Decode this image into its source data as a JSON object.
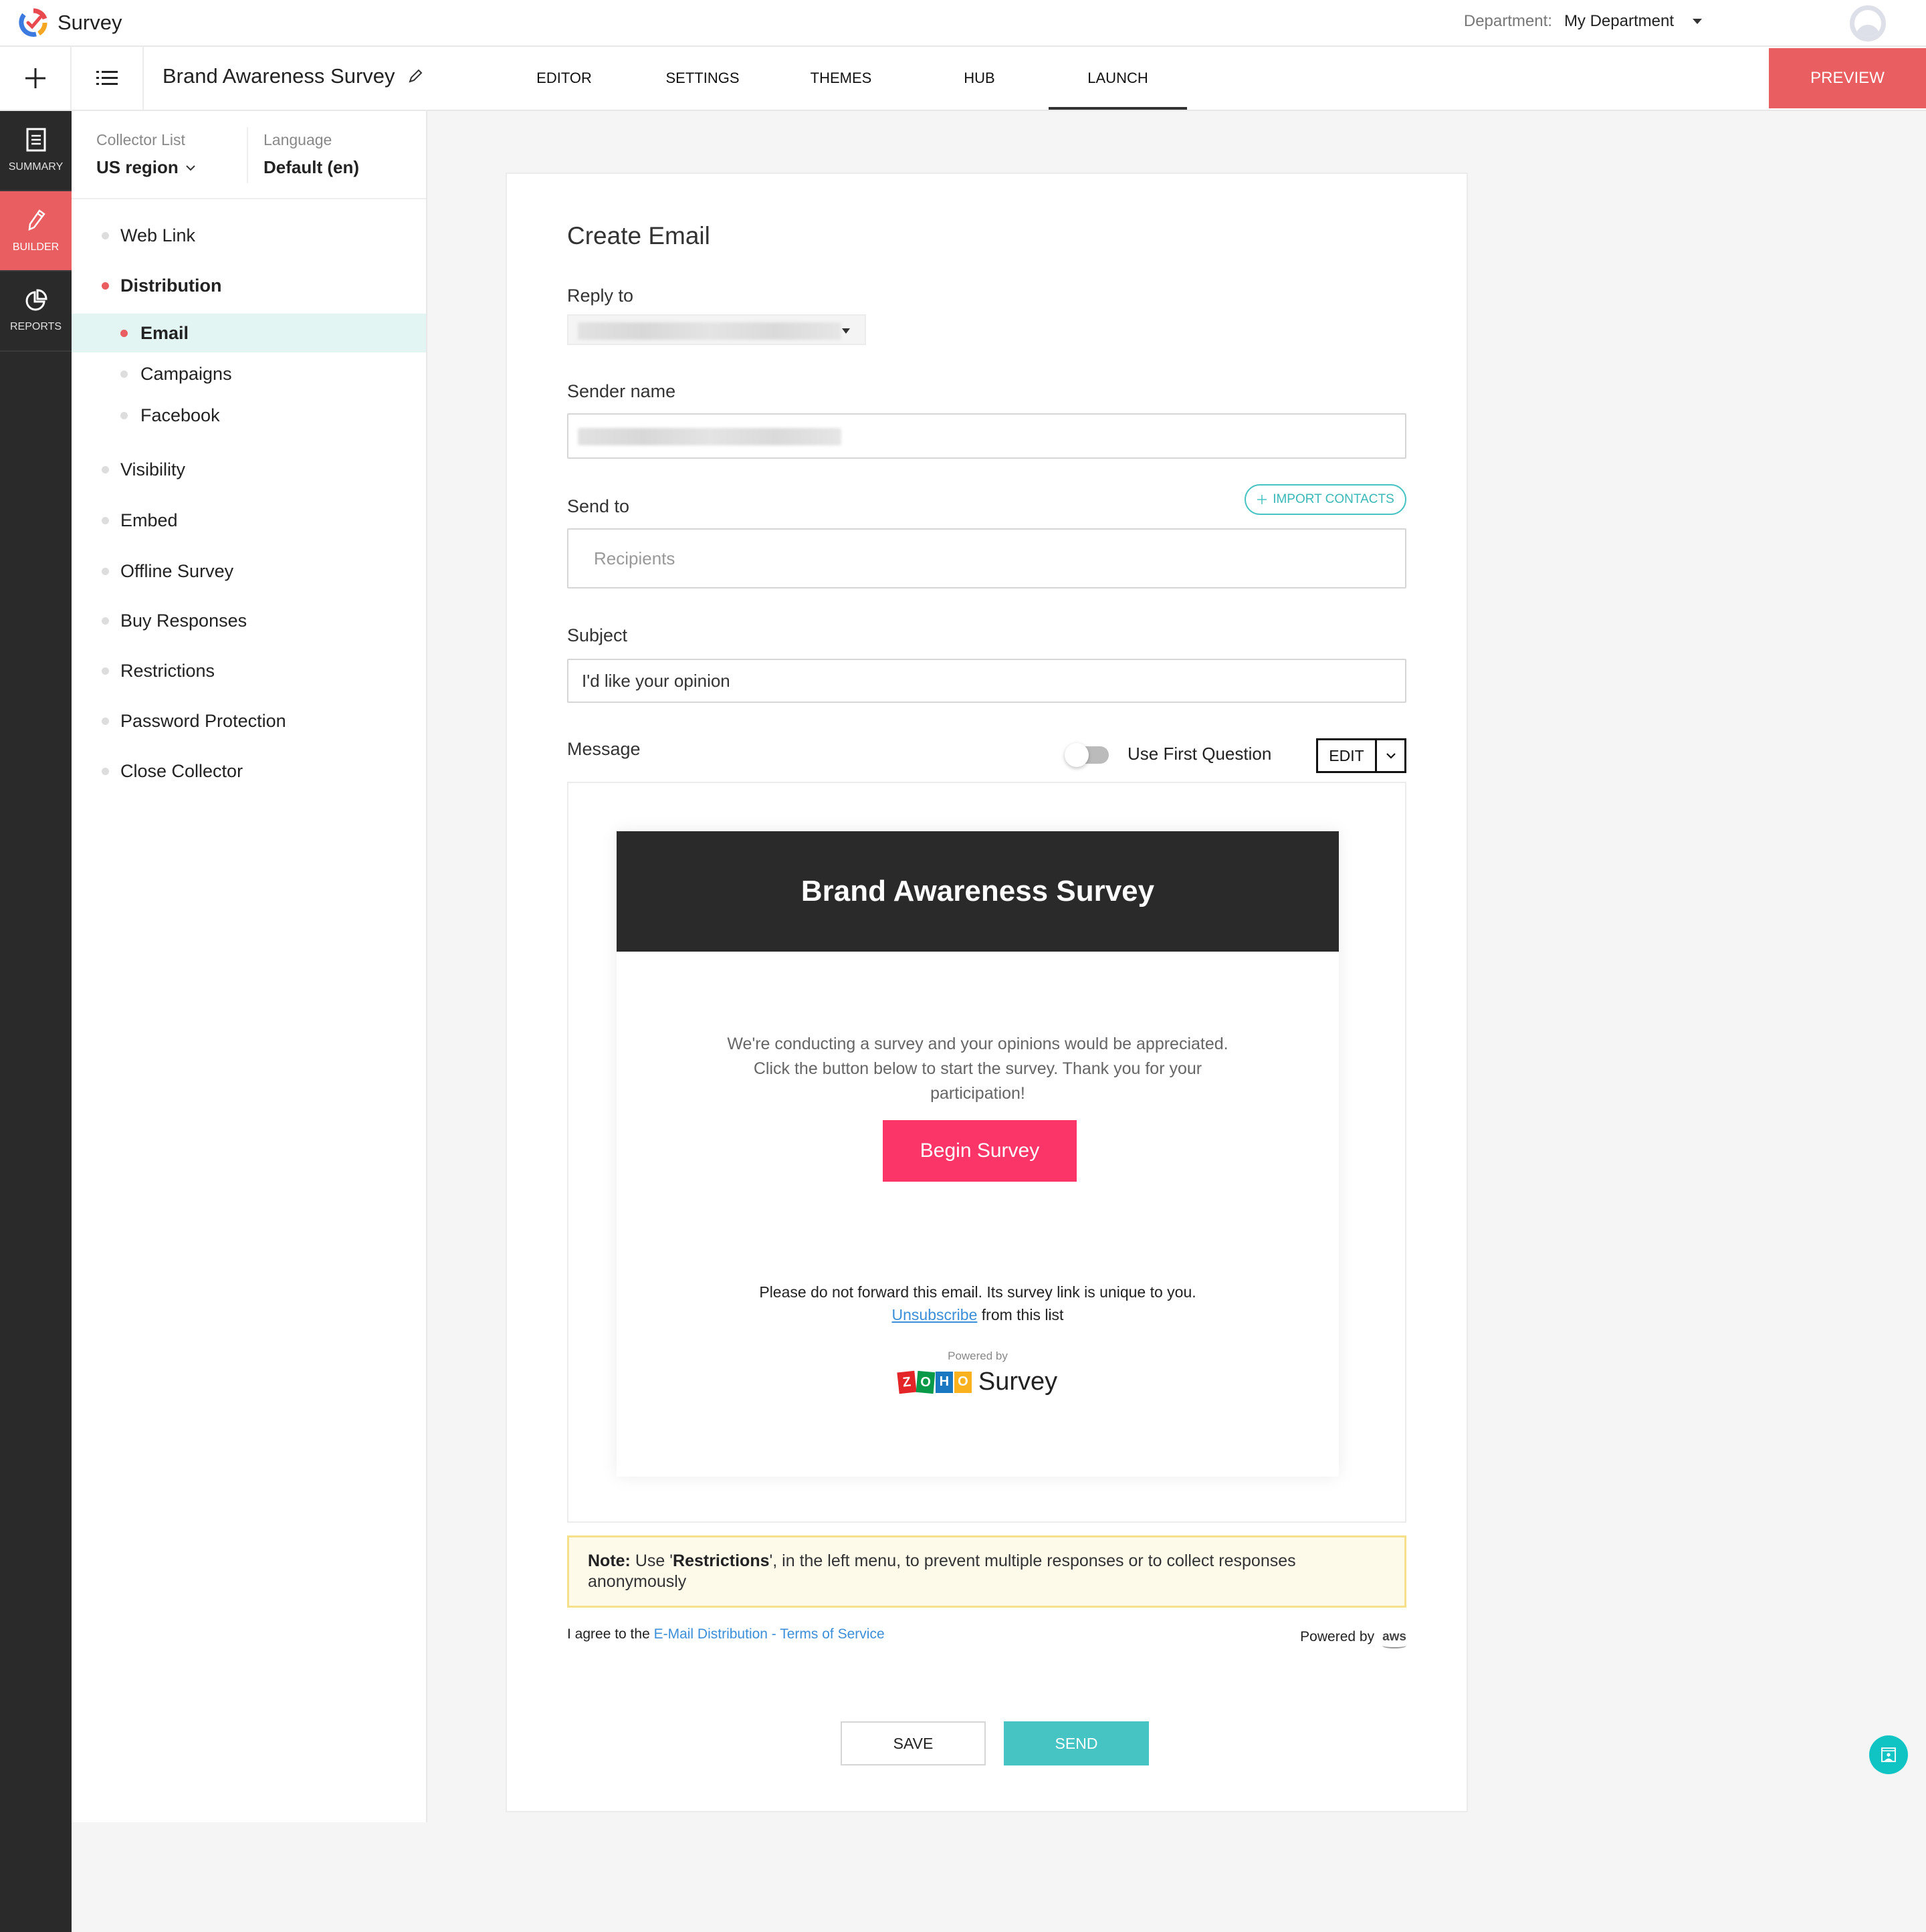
{
  "app": {
    "name": "Survey",
    "department_label": "Department:",
    "department_value": "My Department"
  },
  "navbar": {
    "survey_title": "Brand Awareness Survey",
    "tabs": [
      {
        "label": "EDITOR",
        "active": false
      },
      {
        "label": "SETTINGS",
        "active": false
      },
      {
        "label": "THEMES",
        "active": false
      },
      {
        "label": "HUB",
        "active": false
      },
      {
        "label": "LAUNCH",
        "active": true
      }
    ],
    "preview_label": "PREVIEW"
  },
  "rail": {
    "items": [
      {
        "label": "SUMMARY",
        "icon": "document-icon",
        "active": false
      },
      {
        "label": "BUILDER",
        "icon": "pencil-icon",
        "active": true
      },
      {
        "label": "REPORTS",
        "icon": "pie-chart-icon",
        "active": false
      }
    ]
  },
  "sidebar": {
    "collector_label": "Collector List",
    "collector_value": "US region",
    "language_label": "Language",
    "language_value": "Default (en)",
    "menu": [
      {
        "label": "Web Link",
        "level": 1
      },
      {
        "label": "Distribution",
        "level": 1,
        "expanded": true
      },
      {
        "label": "Email",
        "level": 2,
        "selected": true
      },
      {
        "label": "Campaigns",
        "level": 2
      },
      {
        "label": "Facebook",
        "level": 2
      },
      {
        "label": "Visibility",
        "level": 1
      },
      {
        "label": "Embed",
        "level": 1
      },
      {
        "label": "Offline Survey",
        "level": 1
      },
      {
        "label": "Buy Responses",
        "level": 1
      },
      {
        "label": "Restrictions",
        "level": 1
      },
      {
        "label": "Password Protection",
        "level": 1
      },
      {
        "label": "Close Collector",
        "level": 1
      }
    ]
  },
  "form": {
    "heading": "Create Email",
    "reply_to_label": "Reply to",
    "sender_name_label": "Sender name",
    "send_to_label": "Send to",
    "import_contacts_label": "IMPORT CONTACTS",
    "recipients_placeholder": "Recipients",
    "subject_label": "Subject",
    "subject_value": "I'd like your opinion",
    "message_label": "Message",
    "use_first_question_label": "Use First Question",
    "use_first_question_on": false,
    "edit_label": "EDIT"
  },
  "email_preview": {
    "title": "Brand Awareness Survey",
    "body": "We're conducting a survey and your opinions would be appreciated. Click the button below to start the survey. Thank you for your participation!",
    "button_label": "Begin Survey",
    "footer_line1": "Please do not forward this email. Its survey link is unique to you.",
    "unsubscribe_label": "Unsubscribe",
    "footer_line2_rest": " from this list",
    "powered_by": "Powered by",
    "zoho_letters": [
      "Z",
      "O",
      "H",
      "O"
    ],
    "zoho_product": "Survey",
    "colors": {
      "header_bg": "#2a2a2a",
      "button_bg": "#fb3568"
    }
  },
  "note": {
    "prefix": "Note:",
    "text_before": " Use '",
    "highlight": "Restrictions",
    "text_after": "', in the left menu, to prevent multiple responses or to collect responses anonymously"
  },
  "footer": {
    "agree_text": "I agree to the ",
    "terms_link": "E-Mail Distribution - Terms of Service",
    "powered_by": "Powered by",
    "aws": "aws",
    "save_label": "SAVE",
    "send_label": "SEND"
  },
  "colors": {
    "accent_red": "#e95e61",
    "teal": "#46c4c4",
    "link_blue": "#3b8ed8"
  }
}
